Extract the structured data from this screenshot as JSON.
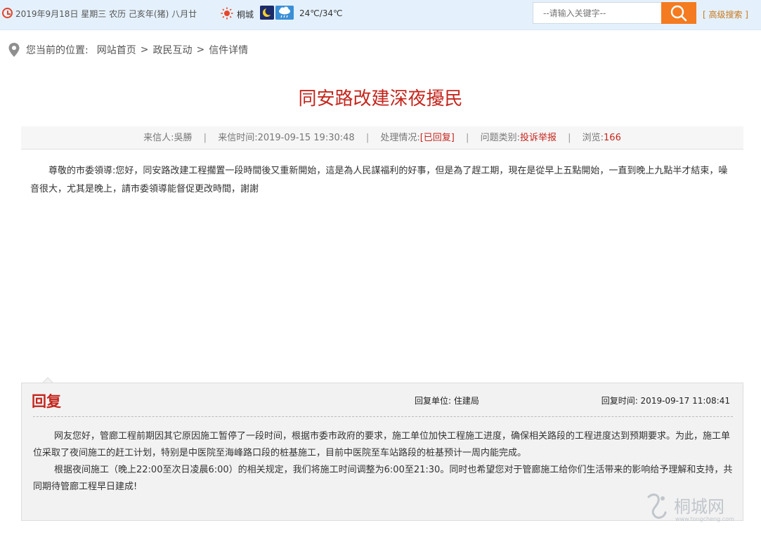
{
  "topbar": {
    "date_line": "2019年9月18日 星期三 农历 己亥年(猪) 八月廿",
    "city": "桐城",
    "temperature": "24℃/34℃",
    "search_placeholder": "--请输入关键字--",
    "advanced_search": "[ 高级搜索 ]",
    "icons": [
      "clock-icon",
      "sun-icon",
      "moon-icon",
      "rain-cloud-icon",
      "search-icon"
    ],
    "colors": {
      "bar": "#e4f1fc",
      "search_button": "#f47b20"
    }
  },
  "breadcrumb": {
    "prefix": "您当前的位置:",
    "items": [
      "网站首页",
      "政民互动",
      "信件详情"
    ],
    "separator": ">"
  },
  "letter": {
    "title": "同安路改建深夜擾民",
    "meta": {
      "sender_label": "来信人:",
      "sender": "吳勝",
      "time_label": "来信时间:",
      "time": "2019-09-15 19:30:48",
      "status_label": "处理情况:",
      "status": "[已回复]",
      "category_label": "问题类别:",
      "category": "投诉举报",
      "views_label": "浏览:",
      "views": "166"
    },
    "body": "尊敬的市委領導:您好，同安路改建工程擱置一段時間後又重新開始，這是為人民謀福利的好事，但是為了趕工期，現在是從早上五點開始，一直到晚上九點半才結束，噪音很大，尤其是晚上，請市委領導能督促更改時間，謝謝"
  },
  "reply": {
    "title": "回复",
    "unit": "回复单位: 住建局",
    "time": "回复时间: 2019-09-17 11:08:41",
    "paragraphs": [
      "网友您好，管廊工程前期因其它原因施工暂停了一段时间，根据市委市政府的要求，施工单位加快工程施工进度，确保相关路段的工程进度达到预期要求。为此，施工单位采取了夜间施工的赶工计划，特别是中医院至海峰路口段的桩基施工，目前中医院至车站路段的桩基预计一周内能完成。",
      "根据夜间施工（晚上22:00至次日凌晨6:00）的相关规定，我们将施工时间调整为6:00至21:30。同时也希望您对于管廊施工给你们生活带来的影响给予理解和支持，共同期待管廊工程早日建成!"
    ]
  },
  "watermark": {
    "text": "桐城网",
    "subtext": "www.tongcheng.com"
  },
  "accent_color": "#c4261d"
}
